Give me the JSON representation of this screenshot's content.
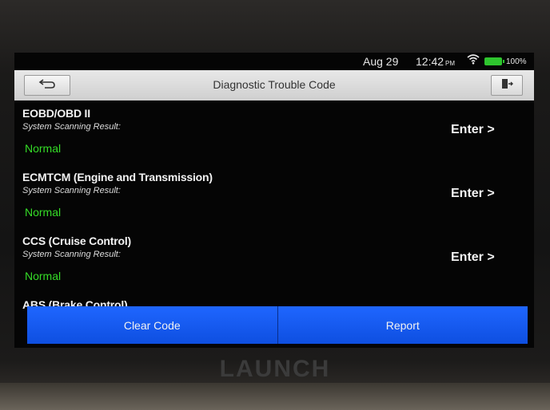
{
  "status_bar": {
    "date": "Aug 29",
    "time": "12:42",
    "ampm": "PM",
    "battery": "100%"
  },
  "header": {
    "title": "Diagnostic Trouble Code",
    "back_icon": "back-arrow-icon",
    "exit_icon": "exit-icon"
  },
  "systems": [
    {
      "name": "EOBD/OBD II",
      "sub": "System Scanning Result:",
      "status": "Normal",
      "enter": "Enter >"
    },
    {
      "name": "ECMTCM (Engine and Transmission)",
      "sub": "System Scanning Result:",
      "status": "Normal",
      "enter": "Enter >"
    },
    {
      "name": "CCS (Cruise Control)",
      "sub": "System Scanning Result:",
      "status": "Normal",
      "enter": "Enter >"
    },
    {
      "name": "ABS (Brake Control)"
    }
  ],
  "buttons": {
    "clear": "Clear Code",
    "report": "Report"
  },
  "brand": "LAUNCH",
  "colors": {
    "status_normal": "#35dd27",
    "button_blue": "#1757f0"
  }
}
